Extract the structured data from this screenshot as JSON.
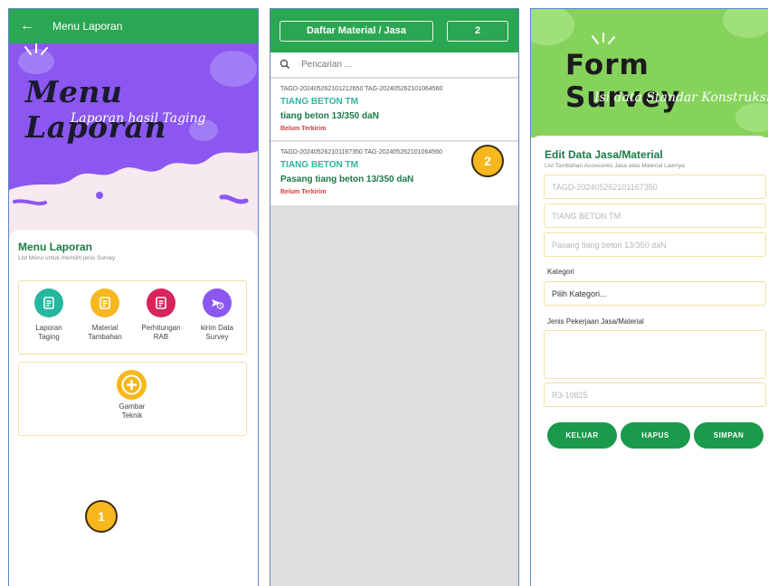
{
  "menu_screen": {
    "appbar": {
      "back_icon": "arrow-left-icon",
      "title": "Menu Laporan"
    },
    "hero": {
      "title": "Menu Laporan",
      "subtitle": "Laporan hasil Taging",
      "bg_color": "#8b57f0"
    },
    "card": {
      "title": "Menu Laporan",
      "subtitle": "List Menu untuk memilih jenis Survey",
      "items": [
        {
          "line1": "Laporan",
          "line2": "Taging",
          "color": "#25b79f",
          "icon": "document-icon"
        },
        {
          "line1": "Material",
          "line2": "Tambahan",
          "color": "#f7b71d",
          "icon": "document-icon"
        },
        {
          "line1": "Perhitungan",
          "line2": "RAB",
          "color": "#d9245a",
          "icon": "document-icon"
        },
        {
          "line1": "kirim Data",
          "line2": "Survey",
          "color": "#8b57f0",
          "icon": "send-clock-icon"
        }
      ],
      "extra": {
        "line1": "Gambar",
        "line2": "Teknik",
        "color": "#f7b71d",
        "icon": "plus-icon"
      }
    },
    "marker": "1"
  },
  "list_screen": {
    "header": {
      "title": "Daftar Material / Jasa",
      "count": "2"
    },
    "search": {
      "placeholder": "Pencarian ..."
    },
    "items": [
      {
        "tag": "TAGD-202405262101212650  TAG-202405262101064560",
        "name": "TIANG BETON TM",
        "desc": "tiang beton 13/350 daN",
        "status": "Belum Terkirim"
      },
      {
        "tag": "TAGD-202405262101167350  TAG-202405262101064560",
        "name": "TIANG BETON TM",
        "desc": "Pasang tiang beton 13/350 daN",
        "status": "Belum Terkirim"
      }
    ],
    "marker": "2"
  },
  "form_screen": {
    "hero": {
      "title": "Form Survey",
      "subtitle": "Isi data Standar Konstruksi"
    },
    "title": "Edit Data Jasa/Material",
    "subtitle": "List Tambahan Accesories Jasa atau Material Lainnya",
    "fields": {
      "tagd": "TAGD-202405262101167350",
      "material": "TIANG BETON TM",
      "description": "Pasang tiang beton 13/350 daN"
    },
    "kategori": {
      "label": "Kategori",
      "value": "Pilih Kategori..."
    },
    "jenis": {
      "label": "Jenis Pekerjaan Jasa/Material",
      "value": ""
    },
    "code": "R3-10825",
    "buttons": {
      "keluar": "KELUAR",
      "hapus": "HAPUS",
      "simpan": "SIMPAN"
    }
  }
}
